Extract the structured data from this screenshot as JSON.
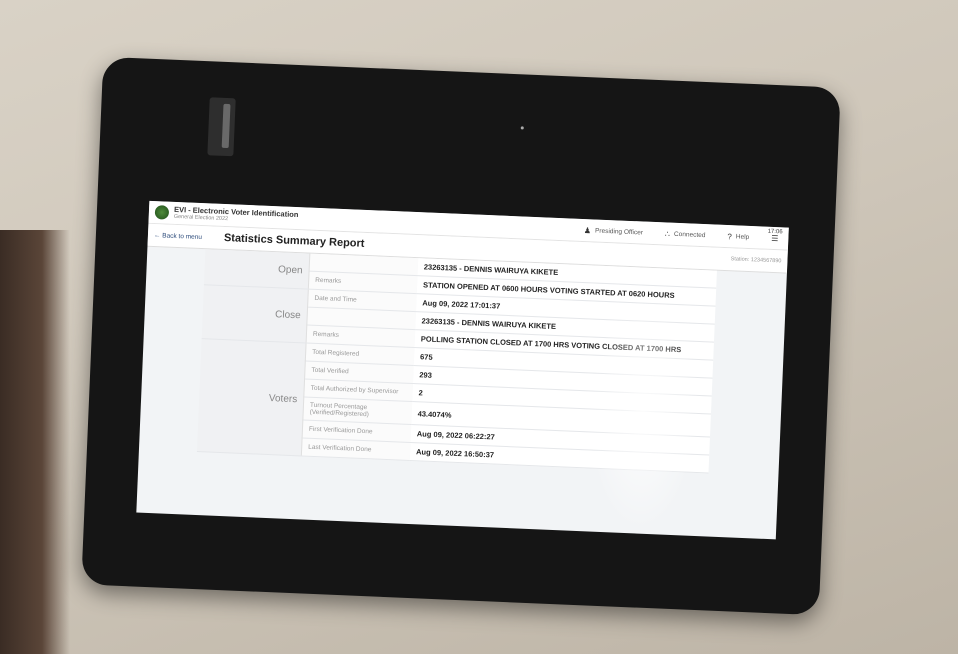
{
  "app": {
    "title": "EVI - Electronic Voter Identification",
    "subtitle": "General Election 2022",
    "presiding_officer": "Presiding Officer",
    "connection": "Connected",
    "help": "Help",
    "status_time": "17:06"
  },
  "report": {
    "back_label": "Back to menu",
    "title": "Statistics Summary Report",
    "subtitle": "Station: 1234567890"
  },
  "open": {
    "section": "Open",
    "officer_partial": "23263135 - DENNIS WAIRUYA KIKETE",
    "remarks_label": "Remarks",
    "remarks_value": "STATION OPENED AT 0600 HOURS VOTING STARTED AT 0620 HOURS"
  },
  "close": {
    "section": "Close",
    "datetime_label": "Date and Time",
    "datetime_value": "Aug 09, 2022 17:01:37",
    "officer_value": "23263135 - DENNIS WAIRUYA KIKETE",
    "remarks_label": "Remarks",
    "remarks_value": "POLLING STATION CLOSED AT 1700 HRS VOTING CLOSED AT 1700 HRS"
  },
  "voters": {
    "section": "Voters",
    "rows": [
      {
        "label": "Total Registered",
        "value": "675"
      },
      {
        "label": "Total Verified",
        "value": "293"
      },
      {
        "label": "Total Authorized by Supervisor",
        "value": "2"
      },
      {
        "label": "Turnout Percentage (Verified/Registered)",
        "value": "43.4074%"
      },
      {
        "label": "First Verification Done",
        "value": "Aug 09, 2022 06:22:27"
      },
      {
        "label": "Last Verification Done",
        "value": "Aug 09, 2022 16:50:37"
      }
    ]
  },
  "icons": {
    "officer": "person-icon",
    "connection": "signal-icon",
    "help": "question-icon",
    "menu": "hamburger-menu-icon",
    "back": "arrow-left-icon"
  },
  "colors": {
    "screen_bg": "#f2f4f6",
    "tablet_frame": "#151515",
    "accent": "#2b4a7a"
  }
}
